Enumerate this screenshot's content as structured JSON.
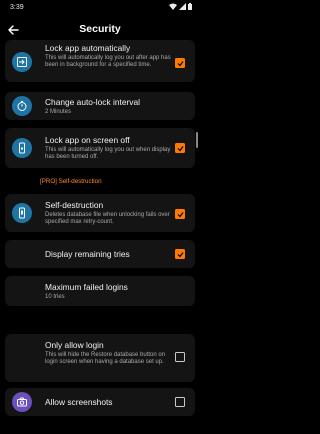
{
  "status": {
    "time": "3:39"
  },
  "toolbar": {
    "title": "Security"
  },
  "items": [
    {
      "title": "Lock app automatically",
      "desc": "This will automatically log you out after app has been in background for a specified time.",
      "checked": true,
      "icon": "exit-icon"
    },
    {
      "title": "Change auto-lock interval",
      "desc": "2 Minutes",
      "icon": "timer-icon"
    },
    {
      "title": "Lock app on screen off",
      "desc": "This will automatically log you out when display has been turned off.",
      "checked": true,
      "icon": "phone-lock-icon"
    },
    {
      "title": "Self-destruction",
      "desc": "Deletes database file when unlocking fails over specified max retry-count.",
      "checked": true,
      "icon": "phone-erase-icon"
    },
    {
      "title": "Display remaining tries",
      "checked": true
    },
    {
      "title": "Maximum failed logins",
      "desc": "10 tries"
    },
    {
      "title": "Only allow login",
      "desc": "This will hide the Restore database button on login screen when having a database set up.",
      "checked": false
    },
    {
      "title": "Allow screenshots",
      "checked": false,
      "icon": "camera-icon"
    }
  ],
  "section": {
    "label": "[PRO] Self-destruction"
  },
  "colors": {
    "accent": "#ff7900",
    "icon_blue": "#1f74a6",
    "icon_purple": "#6b4fbb",
    "card": "#141414",
    "background": "#000000"
  }
}
